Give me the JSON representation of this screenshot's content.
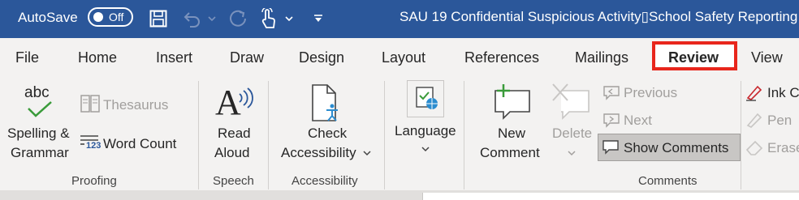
{
  "titlebar": {
    "autosave_label": "AutoSave",
    "autosave_state": "Off",
    "document_title": "SAU 19 Confidential Suspicious Activity▯School Safety Reporting",
    "background_color": "#2b579a"
  },
  "tabs": {
    "items": [
      "File",
      "Home",
      "Insert",
      "Draw",
      "Design",
      "Layout",
      "References",
      "Mailings",
      "Review",
      "View"
    ],
    "active": "Review",
    "highlight_color": "#e8261c"
  },
  "ribbon": {
    "proofing": {
      "spelling_glyph": "abc",
      "spelling_label_1": "Spelling &",
      "spelling_label_2": "Grammar",
      "thesaurus_label": "Thesaurus",
      "word_count_icon_text": "123",
      "word_count_label": "Word Count",
      "group_label": "Proofing"
    },
    "speech": {
      "read_aloud_glyph": "A",
      "read_aloud_label_1": "Read",
      "read_aloud_label_2": "Aloud",
      "group_label": "Speech"
    },
    "accessibility": {
      "check_label_1": "Check",
      "check_label_2": "Accessibility",
      "group_label": "Accessibility"
    },
    "language": {
      "label": "Language",
      "group_label": ""
    },
    "comments": {
      "new_label_1": "New",
      "new_label_2": "Comment",
      "delete_label": "Delete",
      "previous_label": "Previous",
      "next_label": "Next",
      "show_comments_label": "Show Comments",
      "group_label": "Comments"
    },
    "ink": {
      "ink_label": "Ink C",
      "pen_label": "Pen",
      "eraser_label": "Erase"
    }
  }
}
